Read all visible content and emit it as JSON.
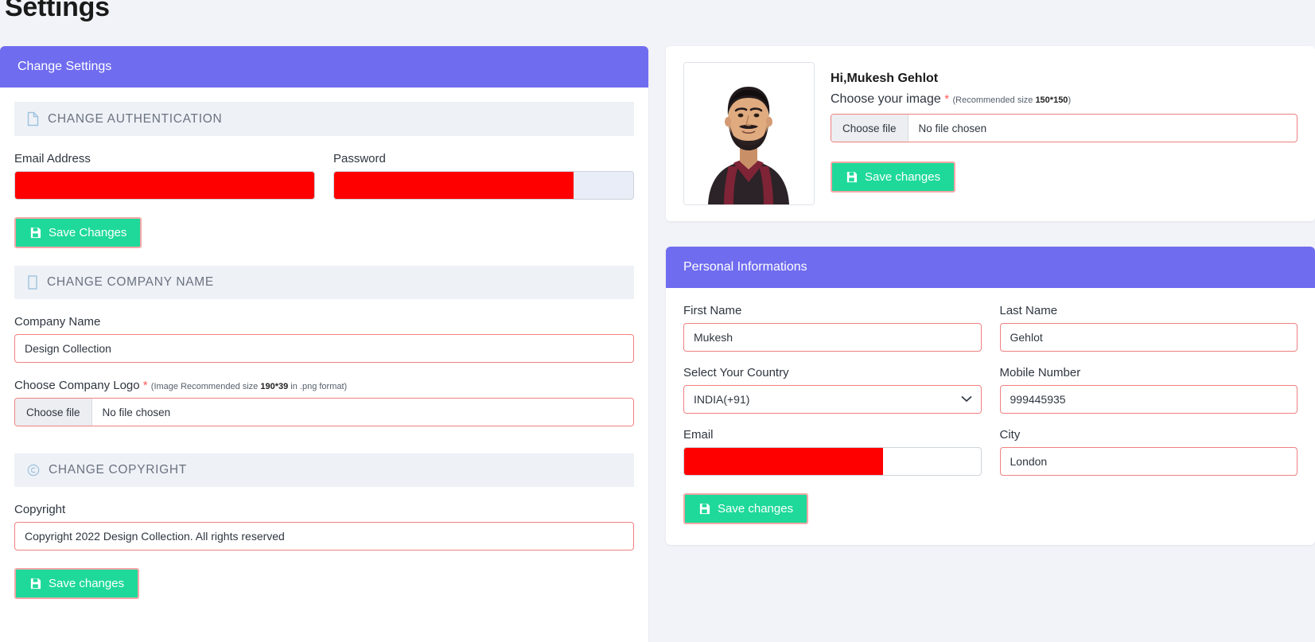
{
  "page": {
    "title": "Settings"
  },
  "theme": {
    "header_purple": "#6f6cf0",
    "button_green": "#1ed99a",
    "validation_red": "#f08080",
    "redaction_red": "#ff0000",
    "section_bg": "#eef1f6",
    "page_bg": "#f2f3f8"
  },
  "left_card": {
    "header": "Change Settings",
    "sections": [
      {
        "icon": "file-icon",
        "title": "CHANGE AUTHENTICATION",
        "fields": {
          "email_label": "Email Address",
          "email_value": "",
          "password_label": "Password",
          "password_value": ""
        },
        "save_label": "Save Changes"
      },
      {
        "icon": "building-icon",
        "title": "CHANGE COMPANY NAME",
        "fields": {
          "company_label": "Company Name",
          "company_value": "Design Collection",
          "logo_label": "Choose Company Logo",
          "logo_required": "*",
          "logo_hint_pre": "(Image Recommended size ",
          "logo_hint_bold": "190*39",
          "logo_hint_post": " in .png format)",
          "choose_file": "Choose file",
          "no_file": "No file chosen"
        }
      },
      {
        "icon": "copyright-icon",
        "title": "CHANGE COPYRIGHT",
        "fields": {
          "copyright_label": "Copyright",
          "copyright_value": "Copyright 2022 Design Collection. All rights reserved"
        },
        "save_label": "Save changes"
      }
    ]
  },
  "profile_card": {
    "avatar_name": "user-avatar-photo",
    "greeting": "Hi,Mukesh Gehlot",
    "choose_image_label": "Choose your image",
    "required": "*",
    "hint_pre": "(Recommended size ",
    "hint_bold": "150*150",
    "hint_post": ")",
    "choose_file": "Choose file",
    "no_file": "No file chosen",
    "save_label": "Save changes"
  },
  "personal_info": {
    "header": "Personal Informations",
    "first_name_label": "First Name",
    "first_name_value": "Mukesh",
    "last_name_label": "Last Name",
    "last_name_value": "Gehlot",
    "country_label": "Select Your Country",
    "country_value": "INDIA(+91)",
    "mobile_label": "Mobile Number",
    "mobile_value": "999445935",
    "email_label": "Email",
    "email_value": "",
    "city_label": "City",
    "city_value": "London",
    "save_label": "Save changes"
  }
}
